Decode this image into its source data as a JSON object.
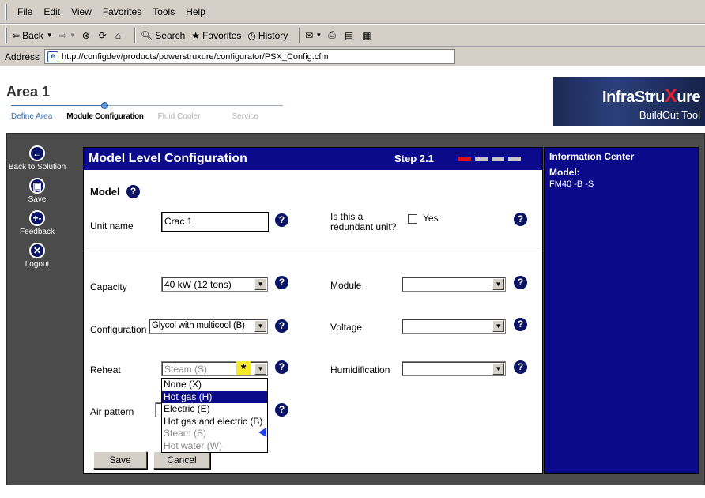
{
  "browser": {
    "menu": [
      "File",
      "Edit",
      "View",
      "Favorites",
      "Tools",
      "Help"
    ],
    "toolbar": {
      "back": "Back",
      "search": "Search",
      "favorites": "Favorites",
      "history": "History"
    },
    "address_label": "Address",
    "url": "http://configdev/products/powerstruxure/configurator/PSX_Config.cfm"
  },
  "page": {
    "area_title": "Area 1",
    "steps": [
      "Define Area",
      "Module Configuration",
      "Fluid Cooler",
      "Service"
    ],
    "current_step_index": 1,
    "logo": {
      "brand_pre": "InfraStru",
      "brand_x": "X",
      "brand_post": "ure",
      "product": "BuildOut Tool"
    }
  },
  "sidebar": {
    "items": [
      {
        "label": "Back to Solution",
        "icon": "back-arrow-icon"
      },
      {
        "label": "Save",
        "icon": "save-icon"
      },
      {
        "label": "Feedback",
        "icon": "feedback-icon"
      },
      {
        "label": "Logout",
        "icon": "logout-icon"
      }
    ]
  },
  "panel": {
    "title": "Model Level Configuration",
    "step_label": "Step 2.1",
    "step_progress": {
      "total": 4,
      "current": 1
    },
    "section": "Model",
    "fields": {
      "unit_name": {
        "label": "Unit name",
        "value": "Crac 1"
      },
      "redundant": {
        "label": "Is this a redundant unit?",
        "option": "Yes",
        "checked": false
      },
      "capacity": {
        "label": "Capacity",
        "value": "40 kW (12 tons)"
      },
      "configuration": {
        "label": "Configuration",
        "value": "Glycol with multicool (B)"
      },
      "reheat": {
        "label": "Reheat",
        "value": "Steam (S)",
        "disabled": true
      },
      "air_pattern": {
        "label": "Air pattern",
        "value": ""
      },
      "module": {
        "label": "Module",
        "value": ""
      },
      "voltage": {
        "label": "Voltage",
        "value": ""
      },
      "humidification": {
        "label": "Humidification",
        "value": ""
      }
    },
    "reheat_options": [
      {
        "label": "None (X)",
        "state": "normal"
      },
      {
        "label": "Hot gas (H)",
        "state": "highlighted"
      },
      {
        "label": "Electric (E)",
        "state": "normal"
      },
      {
        "label": "Hot gas and electric (B)",
        "state": "normal"
      },
      {
        "label": "Steam (S)",
        "state": "disabled"
      },
      {
        "label": "Hot water (W)",
        "state": "disabled"
      }
    ],
    "buttons": {
      "save": "Save",
      "cancel": "Cancel"
    },
    "help_glyph": "?",
    "star_glyph": "*"
  },
  "info_center": {
    "title": "Information Center",
    "model_label": "Model:",
    "model_code": "FM40 -B -S"
  },
  "colors": {
    "panel_header": "#0a0a8a",
    "frame_bg": "#4b4b4b",
    "step_active": "#e01010",
    "highlight_star": "#f4e92a",
    "pointer_arrow": "#2040f0"
  }
}
